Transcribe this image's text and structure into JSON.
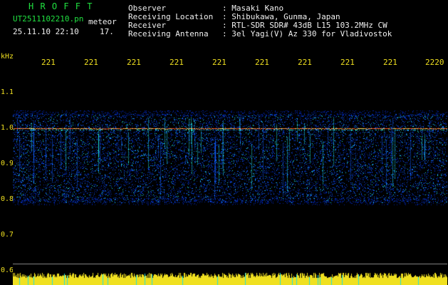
{
  "header": {
    "title": "H R O F F T",
    "filename": "UT2511102210.pn",
    "type_label": "meteor",
    "date_time": "25.11.10 22:10",
    "frame_no": "17."
  },
  "info": {
    "labels": [
      "Observer",
      "Receiving Location",
      "Receiver",
      "Receiving Antenna"
    ],
    "values": [
      ": Masaki Kano",
      ": Shibukawa, Gunma, Japan",
      ": RTL-SDR SDR# 43dB L15 103.2MHz CW",
      ": 3el Yagi(V) Az 330 for Vladivostok"
    ]
  },
  "axis": {
    "unit": "kHz",
    "y_ticks": [
      "1.1",
      "1.0",
      "0.9",
      "0.8",
      "0.7",
      "0.6"
    ],
    "x_ticks": [
      "221",
      "221",
      "221",
      "221",
      "221",
      "221",
      "221",
      "221",
      "221",
      "2220"
    ]
  },
  "colors": {
    "title": "#20e040",
    "labels": "#f0e020",
    "text": "#f0f0f0",
    "noise_low": "#0020a0",
    "noise_mid": "#1060ff",
    "noise_high": "#20e0e0",
    "signal": "#ff5020",
    "baseline": "#f0e020"
  }
}
